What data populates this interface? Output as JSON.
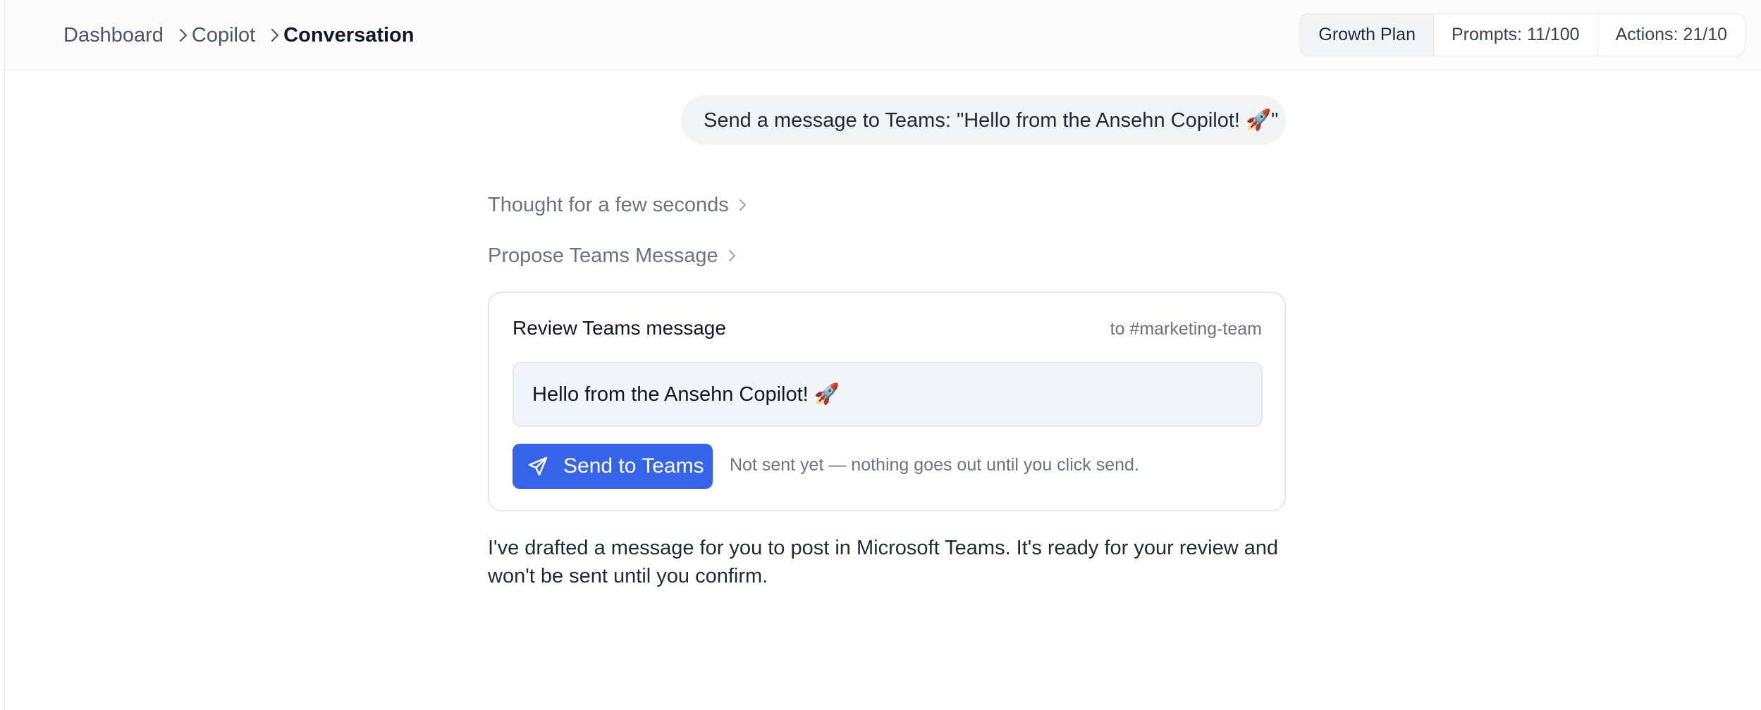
{
  "breadcrumb": {
    "items": [
      {
        "label": "Dashboard"
      },
      {
        "label": "Copilot"
      },
      {
        "label": "Conversation"
      }
    ]
  },
  "plan": {
    "name": "Growth Plan",
    "prompts": "Prompts: 11/100",
    "actions": "Actions: 21/10"
  },
  "conversation": {
    "user_message": "Send a message to Teams: \"Hello from the Ansehn Copilot! 🚀\"",
    "steps": [
      {
        "label": "Thought for a few seconds"
      },
      {
        "label": "Propose Teams Message"
      }
    ],
    "review_card": {
      "title": "Review Teams message",
      "recipient": "to #marketing-team",
      "message": "Hello from the Ansehn Copilot! 🚀",
      "send_label": "Send to Teams",
      "send_icon": "paper-plane-icon",
      "note": "Not sent yet — nothing goes out until you click send."
    },
    "assistant_reply": "I've drafted a message for you to post in Microsoft Teams. It's ready for your review and won't be sent until you confirm."
  },
  "colors": {
    "accent": "#3563e9",
    "muted_text": "#6b7280",
    "bubble_bg": "#f2f3f5",
    "message_box_bg": "#f1f4f8"
  }
}
